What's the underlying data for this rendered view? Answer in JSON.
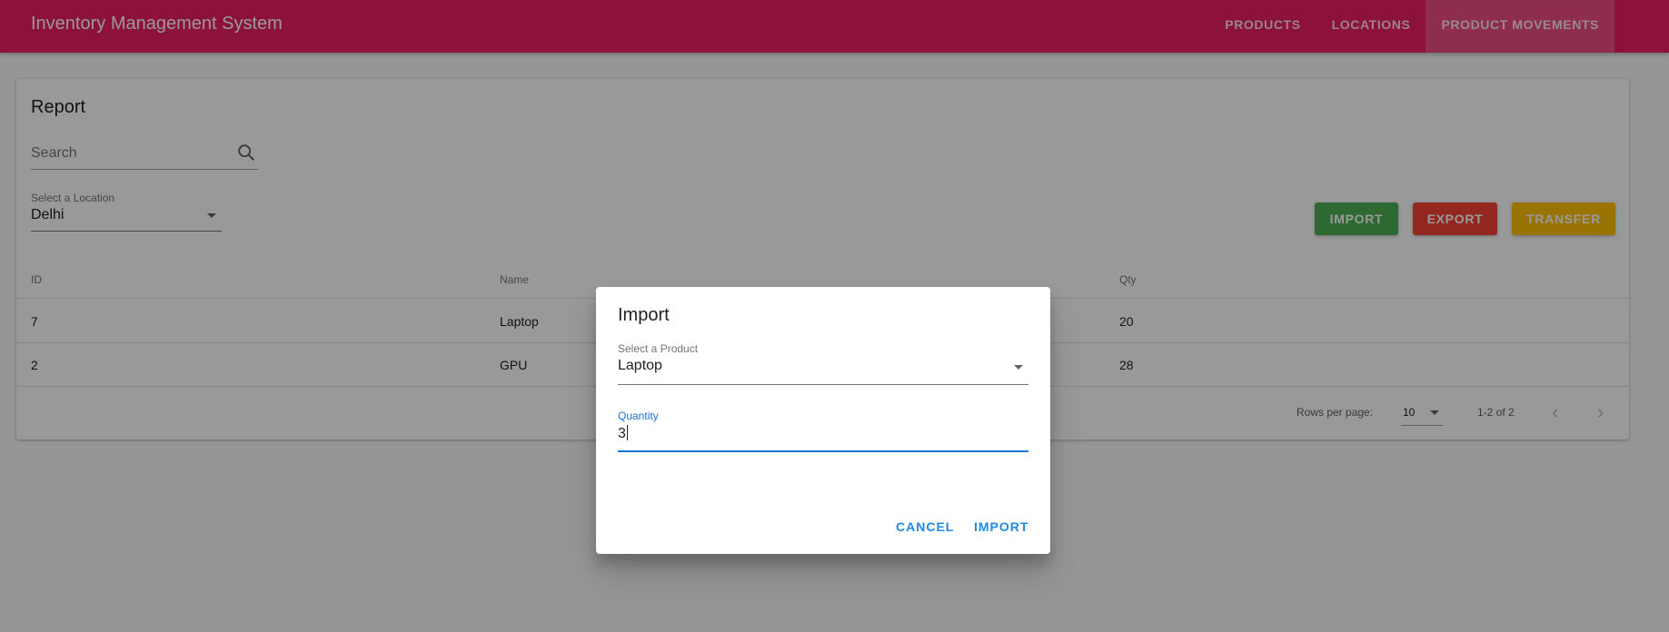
{
  "app": {
    "title": "Inventory Management System",
    "nav": [
      "PRODUCTS",
      "LOCATIONS",
      "PRODUCT MOVEMENTS"
    ],
    "active_nav": "PRODUCT MOVEMENTS",
    "brand_color": "#e91e63"
  },
  "report": {
    "title": "Report",
    "search_placeholder": "Search",
    "location_label": "Select a Location",
    "location_value": "Delhi",
    "buttons": {
      "import": "IMPORT",
      "export": "EXPORT",
      "transfer": "TRANSFER"
    },
    "columns": [
      "ID",
      "Name",
      "Qty"
    ],
    "rows": [
      {
        "id": "7",
        "name": "Laptop",
        "qty": "20"
      },
      {
        "id": "2",
        "name": "GPU",
        "qty": "28"
      }
    ],
    "pagination": {
      "rows_per_page_label": "Rows per page:",
      "rows_per_page": "10",
      "range": "1-2 of 2"
    }
  },
  "dialog": {
    "title": "Import",
    "product_label": "Select a Product",
    "product_value": "Laptop",
    "quantity_label": "Quantity",
    "quantity_value": "3",
    "cancel": "CANCEL",
    "confirm": "IMPORT"
  },
  "icons": [
    "search-icon",
    "dropdown-arrow-icon",
    "chevron-left-icon",
    "chevron-right-icon"
  ]
}
